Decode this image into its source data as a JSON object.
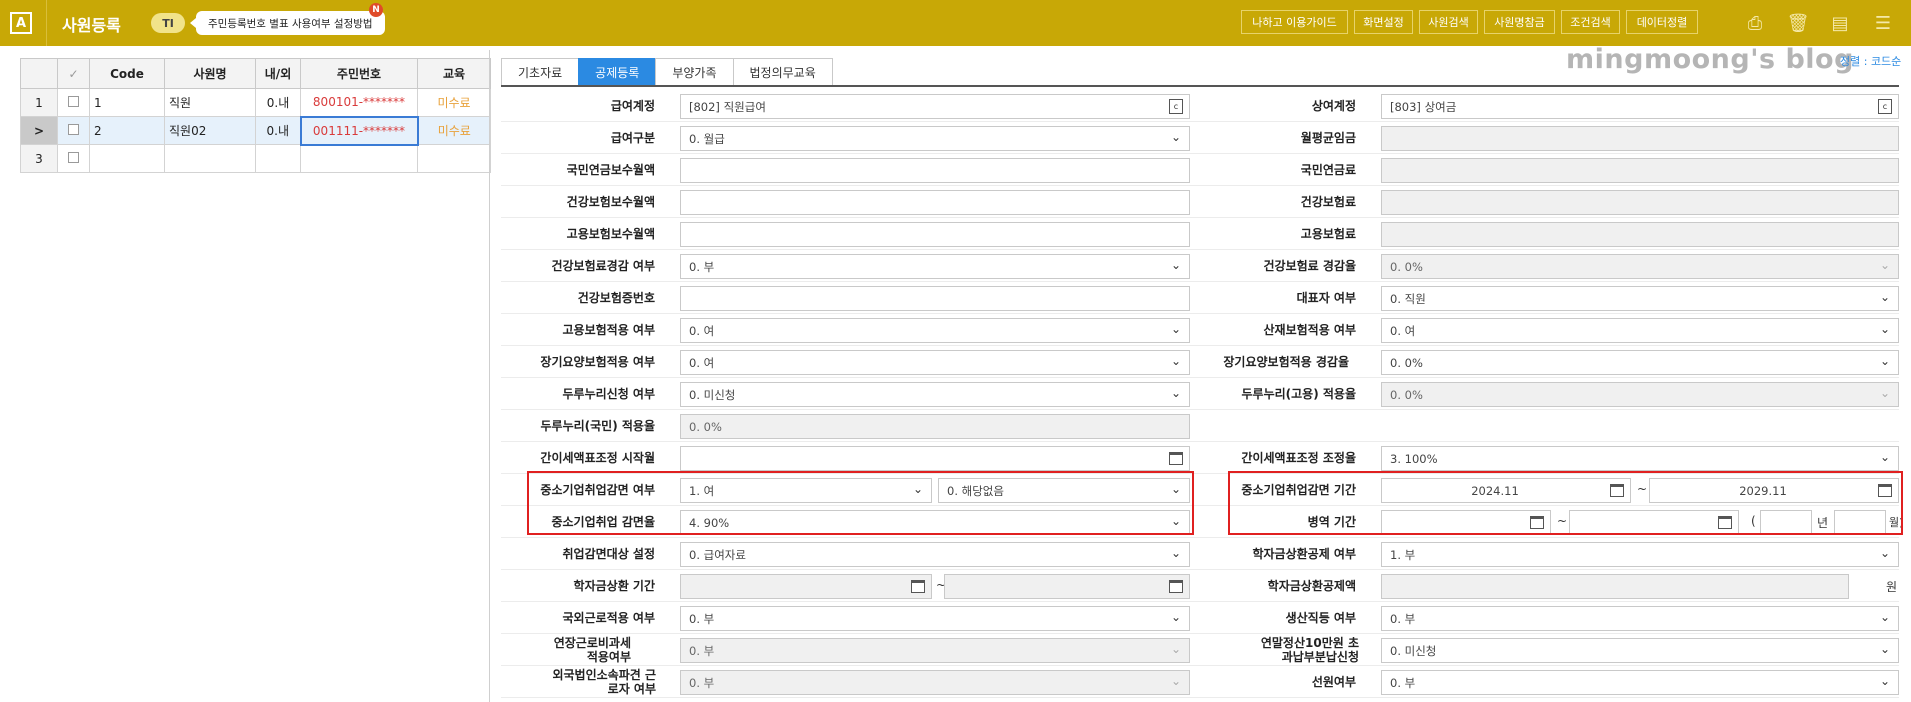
{
  "header": {
    "logo": "A",
    "title": "사원등록",
    "ti_badge": "TI",
    "guide_text": "주민등록번호 별표 사용여부 설정방법",
    "new_badge": "N",
    "buttons": [
      "나하고 이용가이드",
      "화면설정",
      "사원검색",
      "사원명참금",
      "조건검색",
      "데이터정렬"
    ],
    "icons": [
      "print-icon",
      "trash-icon",
      "grid-settings-icon",
      "menu-icon"
    ]
  },
  "grid": {
    "headers": [
      "",
      "✓",
      "Code",
      "사원명",
      "내/외",
      "주민번호",
      "교육"
    ],
    "rows": [
      {
        "row": "1",
        "code": "1",
        "name": "직원",
        "type": "0.내",
        "rrn": "800101-*******",
        "edu": "미수료"
      },
      {
        "row": ">",
        "code": "2",
        "name": "직원02",
        "type": "0.내",
        "rrn": "001111-*******",
        "edu": "미수료"
      },
      {
        "row": "3",
        "code": "",
        "name": "",
        "type": "",
        "rrn": "",
        "edu": ""
      }
    ]
  },
  "tabs": [
    "기초자료",
    "공제등록",
    "부양가족",
    "법정의무교육"
  ],
  "watermark": "mingmoong's blog",
  "sort_label": "정렬 : 코드순",
  "form": {
    "left": [
      {
        "label": "급여계정",
        "value": "[802] 직원급여"
      },
      {
        "label": "급여구분",
        "value": "0. 월급"
      },
      {
        "label": "국민연금보수월액",
        "value": ""
      },
      {
        "label": "건강보험보수월액",
        "value": ""
      },
      {
        "label": "고용보험보수월액",
        "value": ""
      },
      {
        "label": "건강보험료경감 여부",
        "value": "0. 부"
      },
      {
        "label": "건강보험증번호",
        "value": ""
      },
      {
        "label": "고용보험적용 여부",
        "value": "0. 여"
      },
      {
        "label": "장기요양보험적용 여부",
        "value": "0. 여"
      },
      {
        "label": "두루누리신청 여부",
        "value": "0. 미신청"
      },
      {
        "label": "두루누리(국민) 적용율",
        "value": "0. 0%"
      },
      {
        "label": "간이세액표조정 시작월",
        "value": ""
      },
      {
        "label": "중소기업취업감면 여부",
        "value": "1. 여",
        "value2": "0. 해당없음"
      },
      {
        "label": "중소기업취업 감면율",
        "value": "4. 90%"
      },
      {
        "label": "취업감면대상 설정",
        "value": "0. 급여자료"
      },
      {
        "label": "학자금상환 기간",
        "value": ""
      },
      {
        "label": "국외근로적용 여부",
        "value": "0. 부"
      },
      {
        "label": "연장근로비과세 적용여부",
        "value": "0. 부"
      },
      {
        "label": "외국법인소속파견 근로자 여부",
        "value": "0. 부"
      }
    ],
    "right": [
      {
        "label": "상여계정",
        "value": "[803] 상여금"
      },
      {
        "label": "월평균임금",
        "value": ""
      },
      {
        "label": "국민연금료",
        "value": ""
      },
      {
        "label": "건강보험료",
        "value": ""
      },
      {
        "label": "고용보험료",
        "value": ""
      },
      {
        "label": "건강보험료 경감율",
        "value": "0. 0%"
      },
      {
        "label": "대표자 여부",
        "value": "0. 직원"
      },
      {
        "label": "산재보험적용 여부",
        "value": "0. 여"
      },
      {
        "label": "장기요양보험적용 경감율",
        "value": "0. 0%"
      },
      {
        "label": "두루누리(고용) 적용율",
        "value": "0. 0%"
      },
      {
        "label": "",
        "value": ""
      },
      {
        "label": "간이세액표조정 조정율",
        "value": "3. 100%"
      },
      {
        "label": "중소기업취업감면 기간",
        "value": "2024.11",
        "value2": "2029.11"
      },
      {
        "label": "병역 기간",
        "value": "",
        "year_unit": "년",
        "month_unit": "월)"
      },
      {
        "label": "학자금상환공제 여부",
        "value": "1. 부"
      },
      {
        "label": "학자금상환공제액",
        "value": "",
        "unit": "원"
      },
      {
        "label": "생산직등 여부",
        "value": "0. 부"
      },
      {
        "label": "연말정산10만원 초과납부분납신청",
        "value": "0. 미신청"
      },
      {
        "label": "선원여부",
        "value": "0. 부"
      }
    ]
  }
}
